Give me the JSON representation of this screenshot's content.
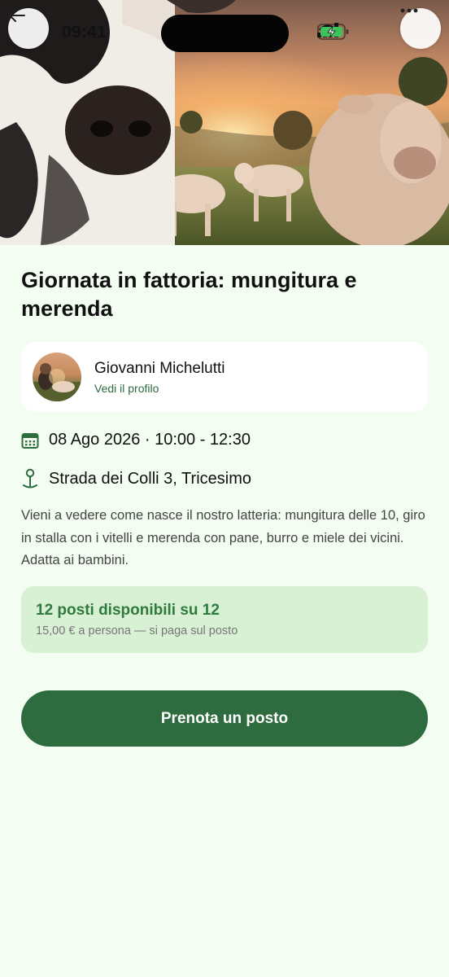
{
  "status_bar": {
    "time": "09:41"
  },
  "hero": {
    "image_alt_icon": "farm-photo"
  },
  "header": {
    "back_icon": "arrow-left-icon",
    "more_icon": "more-dots-icon"
  },
  "event": {
    "title": "Giornata in fattoria: mungitura e merenda",
    "host": {
      "name": "Giovanni Michelutti",
      "profile_link": "Vedi il profilo"
    },
    "date_time": "08 Ago 2026 · 10:00 - 12:30",
    "location": "Strada dei Colli 3, Tricesimo",
    "description": "Vieni a vedere come nasce il nostro latteria: mungitura delle 10, giro in stalla con i vitelli e merenda con pane, burro e miele dei vicini. Adatta ai bambini.",
    "availability": {
      "title": "12 posti disponibili su 12",
      "subtitle": "15,00 € a persona — si paga sul posto"
    },
    "cta_label": "Prenota un posto"
  },
  "colors": {
    "accent": "#2e6b3f",
    "background": "#f3fdf1",
    "availability_bg": "#d8f0d4",
    "availability_text": "#2f7a3e"
  }
}
